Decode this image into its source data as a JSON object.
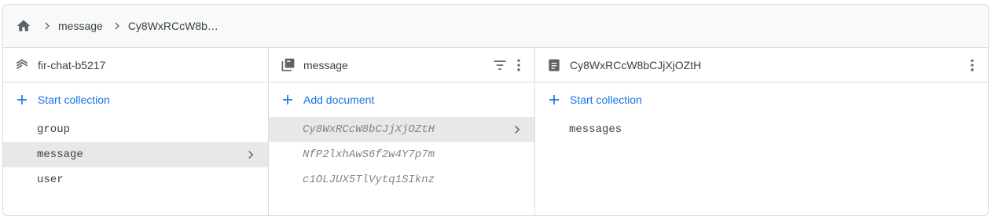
{
  "breadcrumb": {
    "home_icon": "home-icon",
    "items": [
      "message",
      "Cy8WxRCcW8b…"
    ]
  },
  "columns": [
    {
      "header": {
        "icon": "database-stack-icon",
        "title": "fir-chat-b5217"
      },
      "action_label": "Start collection",
      "items": [
        "group",
        "message",
        "user"
      ],
      "selected_index": 1
    },
    {
      "header": {
        "icon": "collection-icon",
        "title": "message"
      },
      "action_label": "Add document",
      "items": [
        "Cy8WxRCcW8bCJjXjOZtH",
        "NfP2lxhAwS6f2w4Y7p7m",
        "c1OLJUX5TlVytq1SIknz"
      ],
      "selected_index": 0
    },
    {
      "header": {
        "icon": "document-icon",
        "title": "Cy8WxRCcW8bCJjXjOZtH"
      },
      "action_label": "Start collection",
      "items": [
        "messages"
      ]
    }
  ],
  "colors": {
    "accent": "#1a73e8",
    "text": "#3c4043",
    "muted": "#80868b",
    "border": "#dadce0",
    "selected_bg": "#e8e8e8",
    "breadcrumb_bg": "#f8f9fa"
  }
}
